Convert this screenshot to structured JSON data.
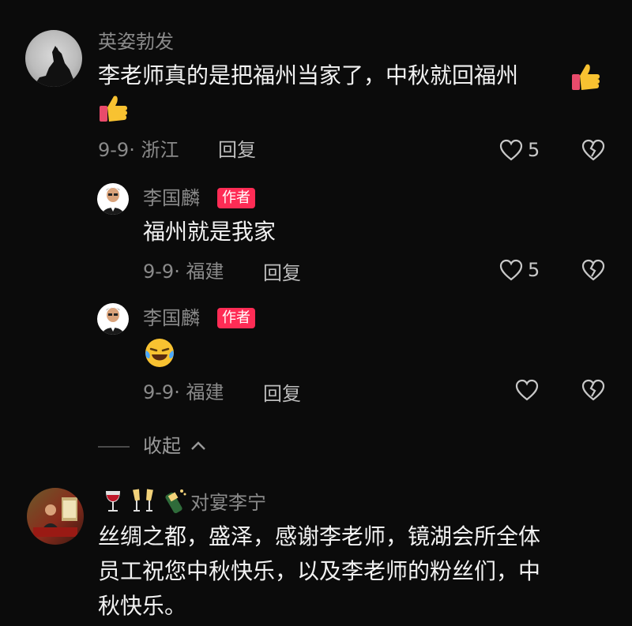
{
  "comments": [
    {
      "user": "英姿勃发",
      "text_line1": "李老师真的是把福州当家了，中秋就回福州",
      "date_location": "9-9· 浙江",
      "reply_label": "回复",
      "likes": "5",
      "emoji": "thumbs-up",
      "replies": [
        {
          "user": "李国麟",
          "badge": "作者",
          "text": "福州就是我家",
          "date_location": "9-9· 福建",
          "reply_label": "回复",
          "likes": "5"
        },
        {
          "user": "李国麟",
          "badge": "作者",
          "emoji": "laughing-crying",
          "date_location": "9-9· 福建",
          "reply_label": "回复"
        }
      ],
      "collapse_label": "收起"
    },
    {
      "user": "对宴李宁",
      "user_emojis": [
        "wine-glass",
        "champagne-glasses",
        "champagne-bottle"
      ],
      "text_line1": "丝绸之都，盛泽，感谢李老师，镜湖会所全体",
      "text_line2": "员工祝您中秋快乐，以及李老师的粉丝们，中",
      "text_line3": "秋快乐。"
    }
  ],
  "colors": {
    "background": "#0b0b0b",
    "badge": "#fe2c55",
    "muted": "#8a8a8a"
  }
}
